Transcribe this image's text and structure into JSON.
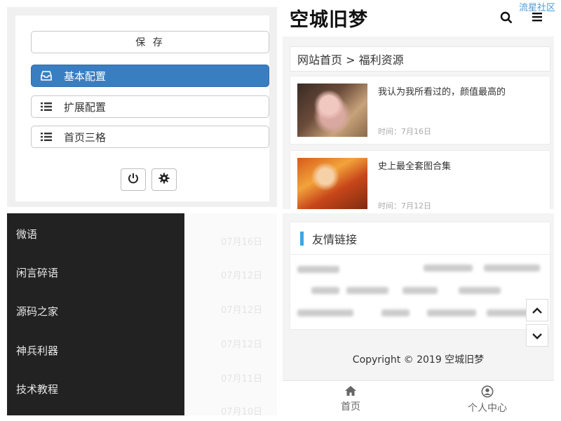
{
  "settings": {
    "save_label": "保 存",
    "menu": [
      {
        "label": "基本配置",
        "icon": "inbox-icon",
        "active": true
      },
      {
        "label": "扩展配置",
        "icon": "list-icon",
        "active": false
      },
      {
        "label": "首页三格",
        "icon": "list-icon",
        "active": false
      }
    ]
  },
  "header": {
    "logo": "空城旧梦"
  },
  "watermark": "流星社区",
  "breadcrumb": "网站首页 > 福利资源",
  "posts": [
    {
      "title": "我认为我所看过的，颜值最高的",
      "date": "时间：7月16日"
    },
    {
      "title": "史上最全套图合集",
      "date": "时间：7月12日"
    }
  ],
  "side_menu": [
    "微语",
    "闲言碎语",
    "源码之家",
    "神兵利器",
    "技术教程"
  ],
  "ghost_dates": [
    "07月16日",
    "07月12日",
    "07月12日",
    "07月12日",
    "07月11日",
    "07月10日"
  ],
  "links_title": "友情链接",
  "copyright": "Copyright © 2019  空城旧梦",
  "tabs": [
    {
      "label": "首页",
      "icon": "home-icon"
    },
    {
      "label": "个人中心",
      "icon": "user-icon"
    }
  ],
  "colors": {
    "accent": "#3a7ec2",
    "link_bar": "#3ea7e0",
    "menu_bg": "#222222"
  }
}
